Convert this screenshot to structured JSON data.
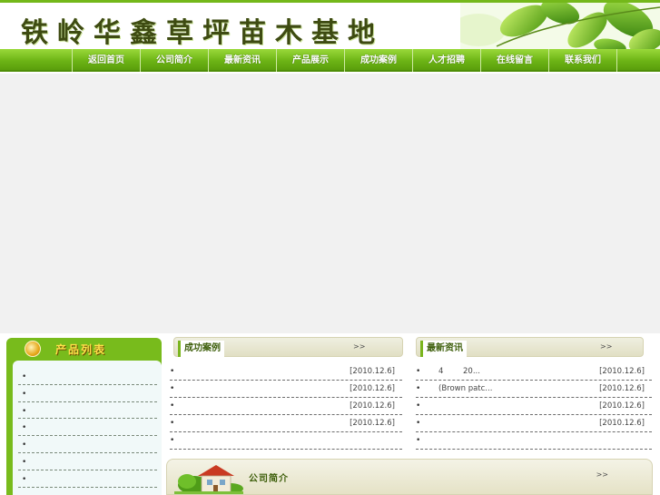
{
  "header": {
    "site_title": "铁岭华鑫草坪苗木基地"
  },
  "nav": {
    "items": [
      {
        "label": "返回首页"
      },
      {
        "label": "公司简介"
      },
      {
        "label": "最新资讯"
      },
      {
        "label": "产品展示"
      },
      {
        "label": "成功案例"
      },
      {
        "label": "人才招聘"
      },
      {
        "label": "在线留言"
      },
      {
        "label": "联系我们"
      }
    ]
  },
  "product_list": {
    "title": "产品列表",
    "bullet": "•"
  },
  "success_cases": {
    "title": "成功案例",
    "more": ">>",
    "rows": [
      {
        "bullet": "•",
        "title": "",
        "date": "[2010.12.6]"
      },
      {
        "bullet": "•",
        "title": "",
        "date": "[2010.12.6]"
      },
      {
        "bullet": "•",
        "title": "",
        "date": "[2010.12.6]"
      },
      {
        "bullet": "•",
        "title": "",
        "date": "[2010.12.6]"
      },
      {
        "bullet": "•",
        "title": "",
        "date": ""
      }
    ]
  },
  "latest_news": {
    "title": "最新资讯",
    "more": ">>",
    "rows": [
      {
        "bullet": "•",
        "title": "4        20...",
        "date": "[2010.12.6]"
      },
      {
        "bullet": "•",
        "title": "(Brown patc...",
        "date": "[2010.12.6]"
      },
      {
        "bullet": "•",
        "title": "",
        "date": "[2010.12.6]"
      },
      {
        "bullet": "•",
        "title": "",
        "date": "[2010.12.6]"
      },
      {
        "bullet": "•",
        "title": "",
        "date": ""
      }
    ]
  },
  "company_intro": {
    "title": "公司简介",
    "more": ">>"
  },
  "colors": {
    "nav_green": "#6eb516",
    "title_dark": "#3e4b12",
    "panel_tab_text": "#3d5e0a",
    "product_title": "#ffe04a"
  },
  "icons": {
    "banner_leaves": "green-leaves-icon",
    "product_list": "gold-coin-icon",
    "company_intro": "house-icon"
  }
}
